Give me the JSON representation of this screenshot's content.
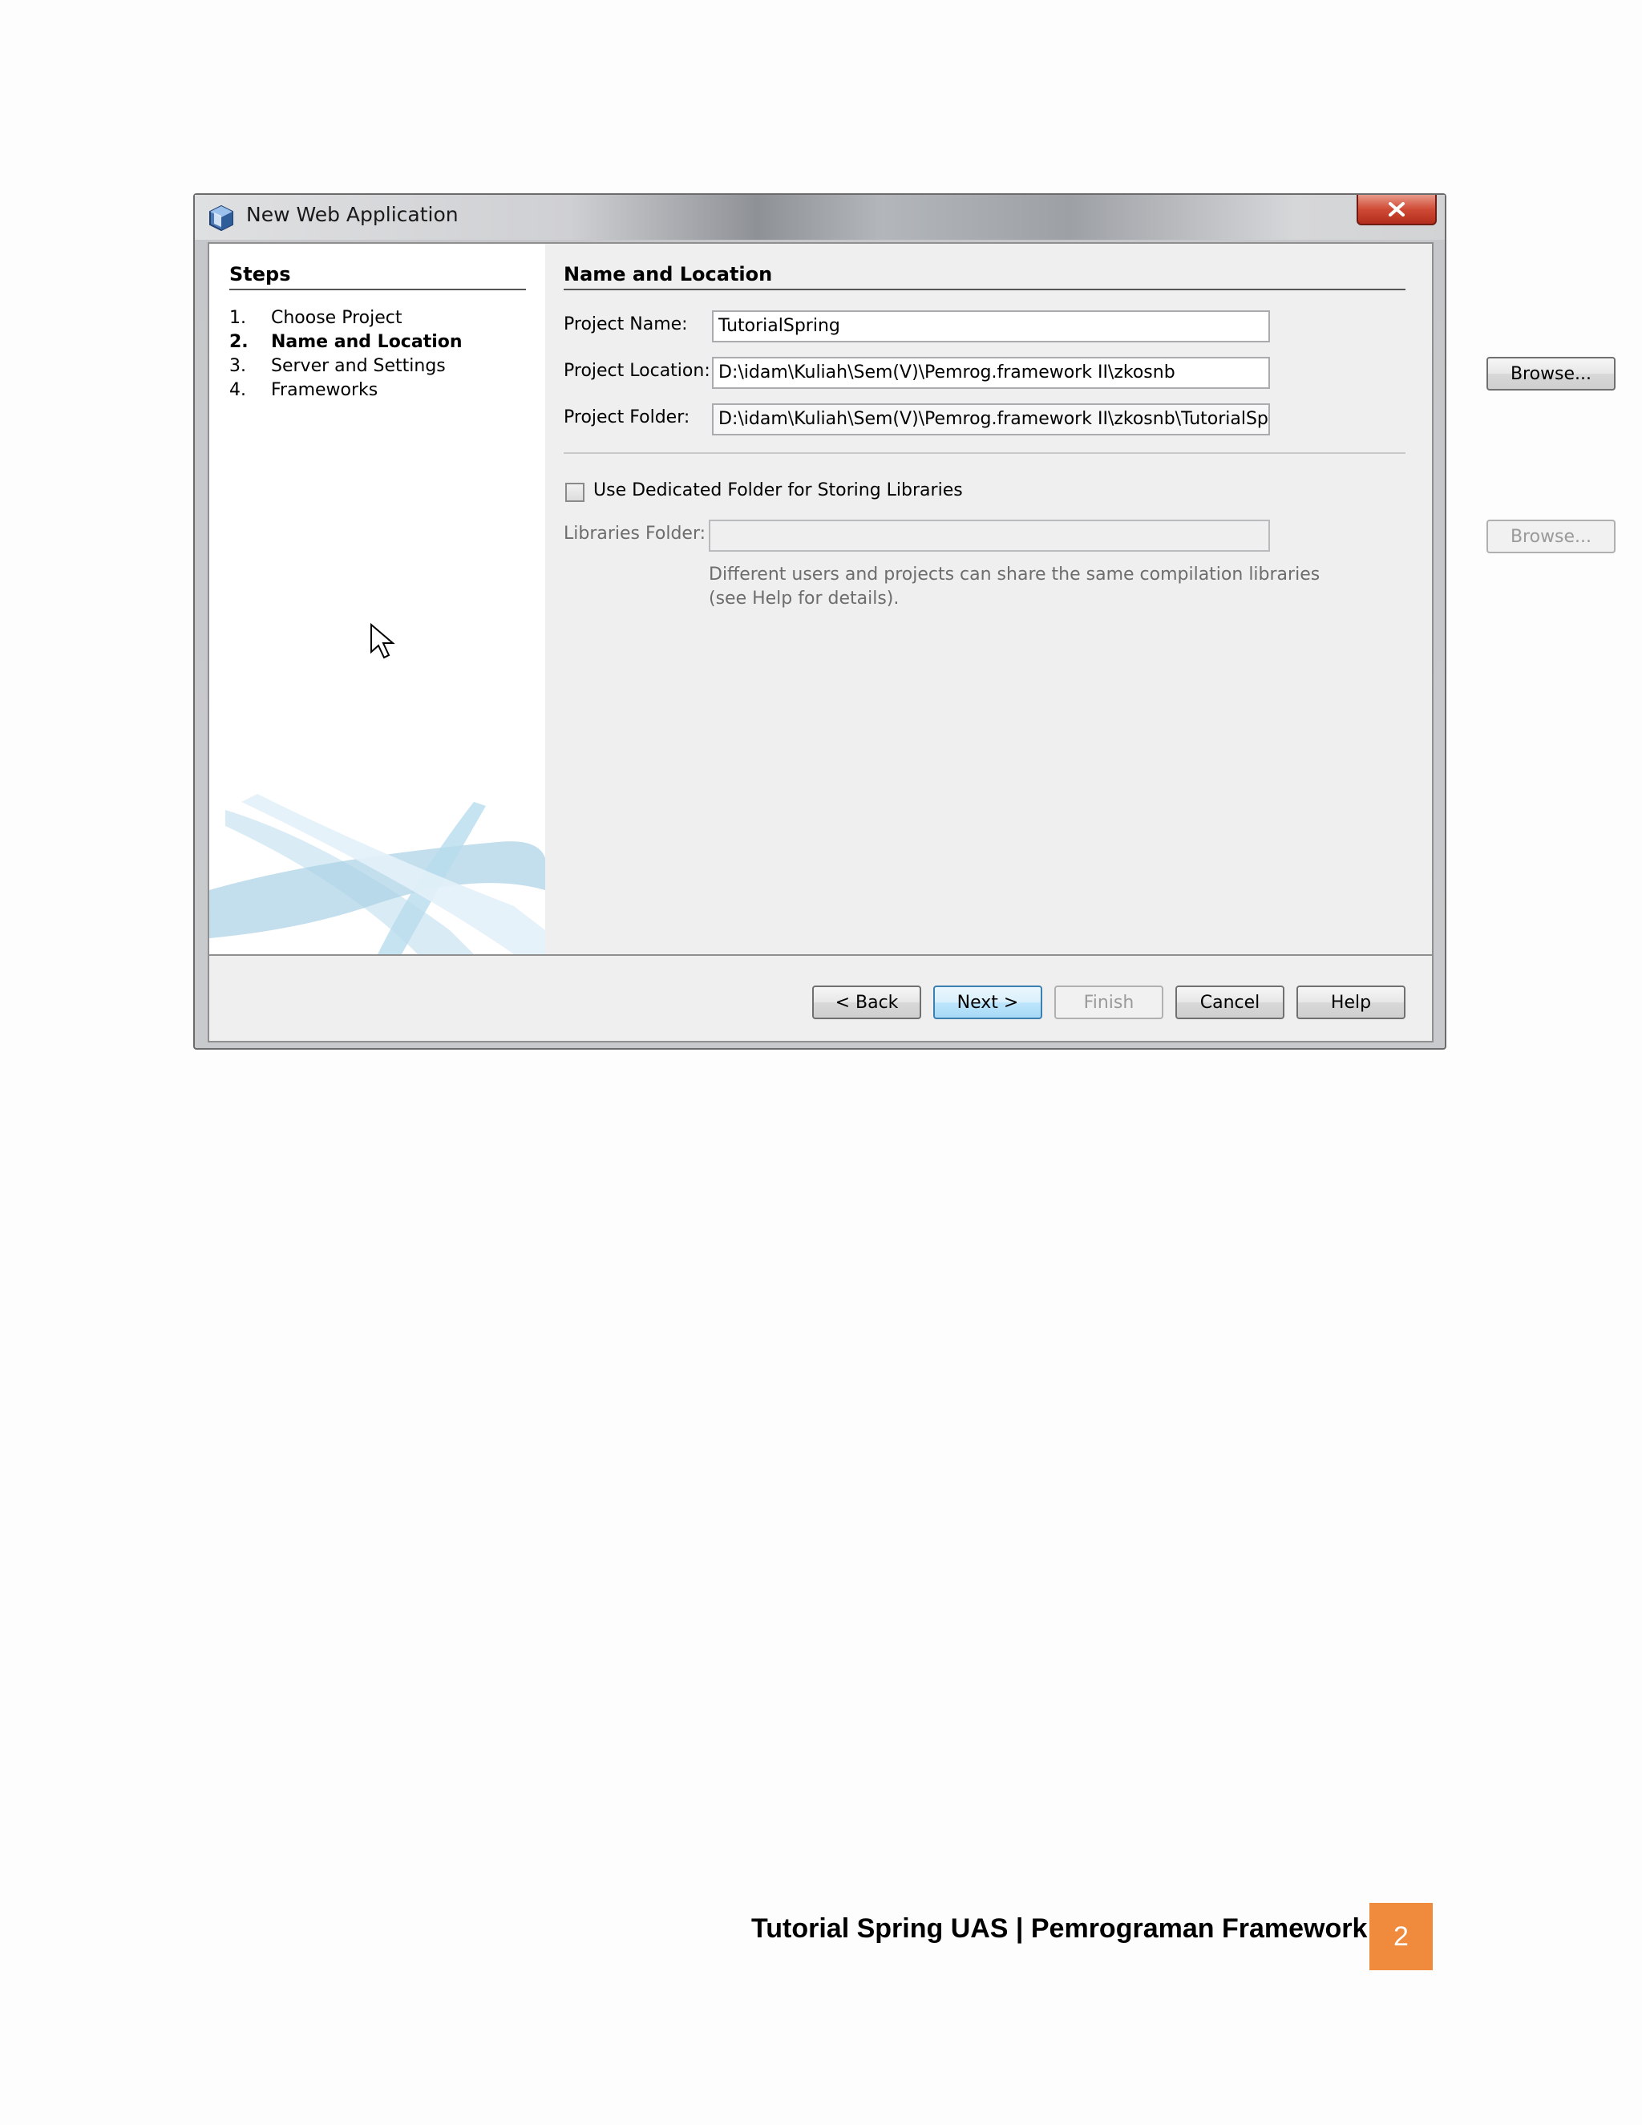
{
  "window": {
    "title": "New Web Application",
    "close_label": "✕"
  },
  "steps": {
    "title": "Steps",
    "items": [
      {
        "num": "1.",
        "label": "Choose Project"
      },
      {
        "num": "2.",
        "label": "Name and Location"
      },
      {
        "num": "3.",
        "label": "Server and Settings"
      },
      {
        "num": "4.",
        "label": "Frameworks"
      }
    ],
    "active_index": 1
  },
  "form": {
    "section_title": "Name and Location",
    "project_name": {
      "label": "Project Name:",
      "value": "TutorialSpring"
    },
    "project_location": {
      "label": "Project Location:",
      "value": "D:\\idam\\Kuliah\\Sem(V)\\Pemrog.framework II\\zkosnb"
    },
    "project_folder": {
      "label": "Project Folder:",
      "value": "D:\\idam\\Kuliah\\Sem(V)\\Pemrog.framework II\\zkosnb\\TutorialSpring"
    },
    "browse_label": "Browse...",
    "dedicated_folder": {
      "label": "Use Dedicated Folder for Storing Libraries",
      "checked": false
    },
    "libraries_folder": {
      "label": "Libraries Folder:",
      "value": ""
    },
    "libraries_browse_label": "Browse...",
    "help_line1": "Different users and projects can share the same compilation libraries",
    "help_line2": "(see Help for details)."
  },
  "buttons": {
    "back": "< Back",
    "next": "Next >",
    "finish": "Finish",
    "cancel": "Cancel",
    "help": "Help"
  },
  "footer": {
    "text": "Tutorial Spring UAS | Pemrograman Framework II",
    "page_number": "2",
    "accent_color": "#f08a3c"
  }
}
